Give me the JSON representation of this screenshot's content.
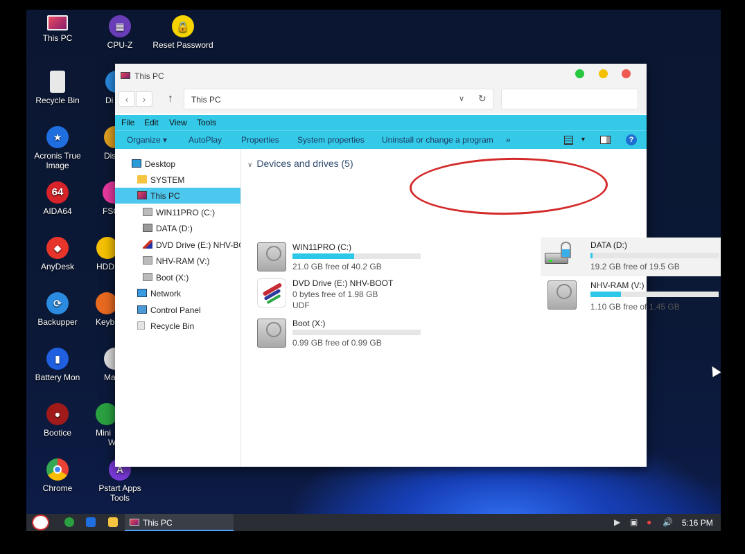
{
  "desktop": {
    "icons": [
      {
        "label": "This PC",
        "icon": "this-pc-icon"
      },
      {
        "label": "CPU-Z",
        "icon": "cpu-z-icon"
      },
      {
        "label": "Reset Password",
        "icon": "reset-password-icon"
      },
      {
        "label": "Recycle Bin",
        "icon": "recycle-bin-icon"
      },
      {
        "label": "Di",
        "icon": "disk-icon"
      },
      {
        "label": "Acronis True Image",
        "icon": "acronis-icon"
      },
      {
        "label": "Dis",
        "icon": "disk-genius-icon"
      },
      {
        "label": "AIDA64",
        "icon": "aida64-icon"
      },
      {
        "label": "FSC",
        "icon": "fsc-icon"
      },
      {
        "label": "AnyDesk",
        "icon": "anydesk-icon"
      },
      {
        "label": "HDD",
        "icon": "hdd-icon"
      },
      {
        "label": "Backupper",
        "icon": "backupper-icon"
      },
      {
        "label": "Keybo",
        "icon": "keyboard-icon"
      },
      {
        "label": "Battery Mon",
        "icon": "battery-mon-icon"
      },
      {
        "label": "Ma",
        "icon": "ma-icon"
      },
      {
        "label": "Bootice",
        "icon": "bootice-icon"
      },
      {
        "label": "Mini",
        "label2": "W",
        "icon": "mini-tool-icon"
      },
      {
        "label": "Chrome",
        "icon": "chrome-icon"
      },
      {
        "label": "Pstart Apps Tools",
        "icon": "pstart-icon"
      }
    ]
  },
  "window": {
    "title": "This PC",
    "address": "This PC",
    "menu": [
      "File",
      "Edit",
      "View",
      "Tools"
    ],
    "toolbar": {
      "organize": "Organize ▾",
      "autoplay": "AutoPlay",
      "properties": "Properties",
      "system_properties": "System properties",
      "uninstall": "Uninstall or change a program",
      "more": "»",
      "help": "?"
    },
    "nav": [
      {
        "label": "Desktop",
        "icon": "desktop-icon"
      },
      {
        "label": "SYSTEM",
        "icon": "folder-icon"
      },
      {
        "label": "This PC",
        "icon": "this-pc-icon"
      },
      {
        "label": "WIN11PRO (C:)",
        "icon": "drive-icon"
      },
      {
        "label": "DATA (D:)",
        "icon": "locked-drive-icon"
      },
      {
        "label": "DVD Drive (E:) NHV-BOOT",
        "icon": "dvd-icon"
      },
      {
        "label": "NHV-RAM (V:)",
        "icon": "drive-icon"
      },
      {
        "label": "Boot (X:)",
        "icon": "drive-icon"
      },
      {
        "label": "Network",
        "icon": "network-icon"
      },
      {
        "label": "Control Panel",
        "icon": "control-panel-icon"
      },
      {
        "label": "Recycle Bin",
        "icon": "recycle-bin-icon"
      }
    ],
    "group_header": "Devices and drives (5)",
    "drives": [
      {
        "name": "WIN11PRO (C:)",
        "free": "21.0 GB free of 40.2 GB",
        "used_fraction": 0.48
      },
      {
        "name": "DATA (D:)",
        "free": "19.2 GB free of 19.5 GB",
        "used_fraction": 0.015
      },
      {
        "name": "DVD Drive (E:) NHV-BOOT",
        "free": "0 bytes free of 1.98 GB",
        "fs": "UDF"
      },
      {
        "name": "NHV-RAM (V:)",
        "free": "1.10 GB free of 1.45 GB",
        "used_fraction": 0.24
      },
      {
        "name": "Boot (X:)",
        "free": "0.99 GB free of 0.99 GB",
        "used_fraction": 0.0
      }
    ]
  },
  "taskbar": {
    "active_task": "This PC",
    "clock": "5:16 PM"
  },
  "colors": {
    "accent": "#35c9e8",
    "selection": "#4cc8ee",
    "bar_fill": "#2dc8e8",
    "annotation": "#d42a2a"
  }
}
